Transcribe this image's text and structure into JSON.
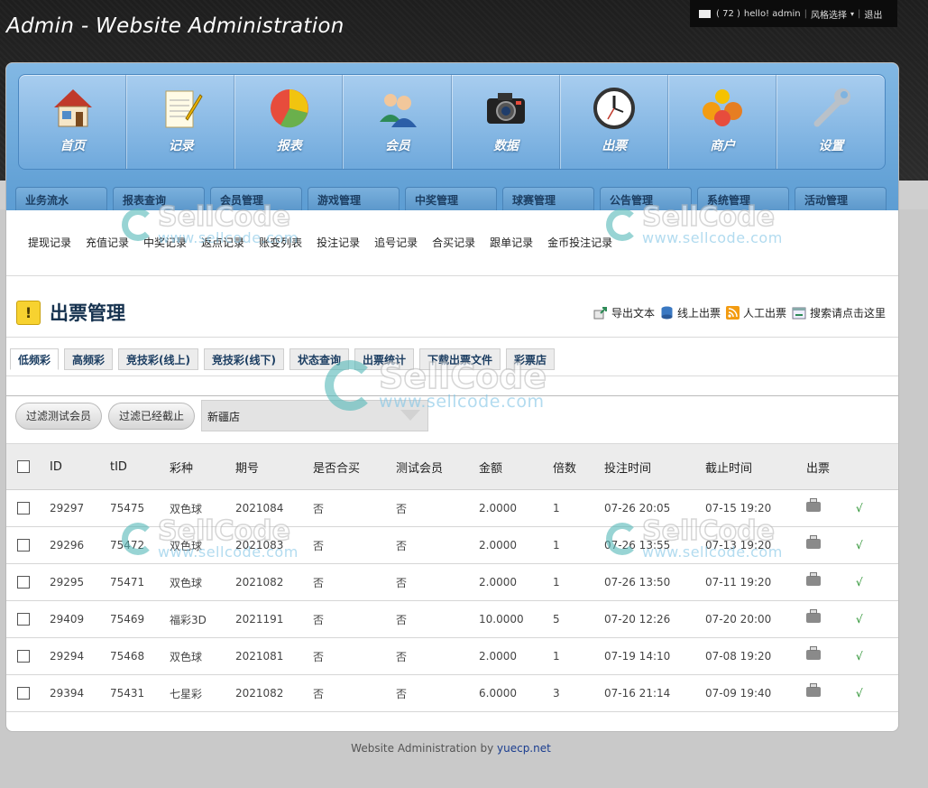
{
  "site_title": "Admin - Website Administration",
  "userbar": {
    "message_count": "( 72 )",
    "greeting": "hello! admin",
    "style_select": "风格选择",
    "logout": "退出"
  },
  "nav": [
    {
      "label": "首页",
      "icon": "home-icon"
    },
    {
      "label": "记录",
      "icon": "notepad-icon"
    },
    {
      "label": "报表",
      "icon": "pie-chart-icon"
    },
    {
      "label": "会员",
      "icon": "users-icon"
    },
    {
      "label": "数据",
      "icon": "camera-icon"
    },
    {
      "label": "出票",
      "icon": "clock-icon"
    },
    {
      "label": "商户",
      "icon": "merchant-icon"
    },
    {
      "label": "设置",
      "icon": "wrench-icon"
    }
  ],
  "category_tabs": [
    "业务流水",
    "报表查询",
    "会员管理",
    "游戏管理",
    "中奖管理",
    "球赛管理",
    "公告管理",
    "系统管理",
    "活动管理"
  ],
  "sub_links": [
    "提现记录",
    "充值记录",
    "中奖记录",
    "返点记录",
    "账变列表",
    "投注记录",
    "追号记录",
    "合买记录",
    "跟单记录",
    "金币投注记录"
  ],
  "page_title": "出票管理",
  "toolbar": {
    "export": "导出文本",
    "online_ticket": "线上出票",
    "manual_ticket": "人工出票",
    "search": "搜索请点击这里"
  },
  "type_tabs": [
    "低频彩",
    "高频彩",
    "竞技彩(线上)",
    "竞技彩(线下)",
    "状态查询",
    "出票统计",
    "下载出票文件",
    "彩票店"
  ],
  "filters": {
    "filter_test": "过滤测试会员",
    "filter_closed": "过滤已经截止",
    "store": "新疆店"
  },
  "table": {
    "headers": [
      "ID",
      "tID",
      "彩种",
      "期号",
      "是否合买",
      "测试会员",
      "金额",
      "倍数",
      "投注时间",
      "截止时间",
      "出票"
    ],
    "rows": [
      {
        "id": "29297",
        "tid": "75475",
        "game": "双色球",
        "issue": "2021084",
        "group": "否",
        "test": "否",
        "amount": "2.0000",
        "multiple": "1",
        "bet_time": "07-26 20:05",
        "close_time": "07-15 19:20",
        "mark": "√"
      },
      {
        "id": "29296",
        "tid": "75472",
        "game": "双色球",
        "issue": "2021083",
        "group": "否",
        "test": "否",
        "amount": "2.0000",
        "multiple": "1",
        "bet_time": "07-26 13:55",
        "close_time": "07-13 19:20",
        "mark": "√"
      },
      {
        "id": "29295",
        "tid": "75471",
        "game": "双色球",
        "issue": "2021082",
        "group": "否",
        "test": "否",
        "amount": "2.0000",
        "multiple": "1",
        "bet_time": "07-26 13:50",
        "close_time": "07-11 19:20",
        "mark": "√"
      },
      {
        "id": "29409",
        "tid": "75469",
        "game": "福彩3D",
        "issue": "2021191",
        "group": "否",
        "test": "否",
        "amount": "10.0000",
        "multiple": "5",
        "bet_time": "07-20 12:26",
        "close_time": "07-20 20:00",
        "mark": "√"
      },
      {
        "id": "29294",
        "tid": "75468",
        "game": "双色球",
        "issue": "2021081",
        "group": "否",
        "test": "否",
        "amount": "2.0000",
        "multiple": "1",
        "bet_time": "07-19 14:10",
        "close_time": "07-08 19:20",
        "mark": "√"
      },
      {
        "id": "29394",
        "tid": "75431",
        "game": "七星彩",
        "issue": "2021082",
        "group": "否",
        "test": "否",
        "amount": "6.0000",
        "multiple": "3",
        "bet_time": "07-16 21:14",
        "close_time": "07-09 19:40",
        "mark": "√"
      }
    ]
  },
  "footer": {
    "text": "Website Administration by",
    "link": "yuecp.net"
  },
  "watermark": {
    "brand": "SellCode",
    "url": "www.sellcode.com"
  }
}
